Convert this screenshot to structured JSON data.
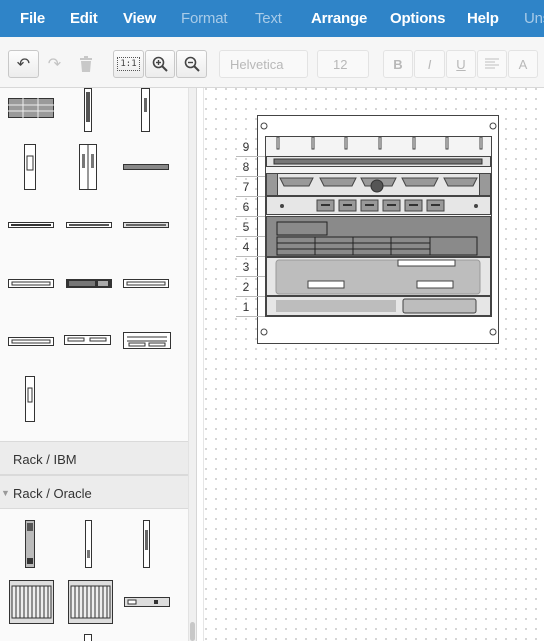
{
  "menu": {
    "file": "File",
    "edit": "Edit",
    "view": "View",
    "format": "Format",
    "text": "Text",
    "arrange": "Arrange",
    "options": "Options",
    "help": "Help",
    "unsaved": "Uns"
  },
  "toolbar": {
    "undo_icon": "↶",
    "redo_icon": "↷",
    "actual_size": "1:1",
    "font_family": "Helvetica",
    "font_size": "12",
    "bold": "B",
    "italic": "I",
    "underline": "U",
    "text_color": "A"
  },
  "sidebar": {
    "sections": [
      {
        "label": "Rack / IBM",
        "expanded": false
      },
      {
        "label": "Rack / Oracle",
        "expanded": true
      }
    ]
  },
  "rack": {
    "units": [
      "9",
      "8",
      "7",
      "6",
      "5",
      "4",
      "3",
      "2",
      "1"
    ]
  },
  "colors": {
    "menubar": "#2f84c8",
    "menu_disabled": "#a8cbe8",
    "rack_fill": "#e6e6e6",
    "device_dark": "#8a8a8a"
  }
}
